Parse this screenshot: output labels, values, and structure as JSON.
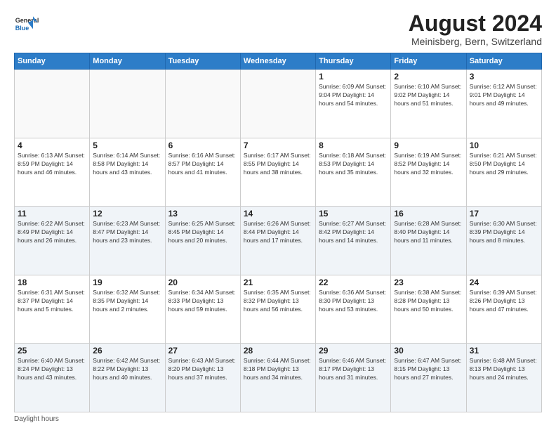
{
  "header": {
    "logo_general": "General",
    "logo_blue": "Blue",
    "month_title": "August 2024",
    "location": "Meinisberg, Bern, Switzerland"
  },
  "days_of_week": [
    "Sunday",
    "Monday",
    "Tuesday",
    "Wednesday",
    "Thursday",
    "Friday",
    "Saturday"
  ],
  "footer": {
    "label": "Daylight hours"
  },
  "weeks": [
    [
      {
        "day": "",
        "detail": ""
      },
      {
        "day": "",
        "detail": ""
      },
      {
        "day": "",
        "detail": ""
      },
      {
        "day": "",
        "detail": ""
      },
      {
        "day": "1",
        "detail": "Sunrise: 6:09 AM\nSunset: 9:04 PM\nDaylight: 14 hours\nand 54 minutes."
      },
      {
        "day": "2",
        "detail": "Sunrise: 6:10 AM\nSunset: 9:02 PM\nDaylight: 14 hours\nand 51 minutes."
      },
      {
        "day": "3",
        "detail": "Sunrise: 6:12 AM\nSunset: 9:01 PM\nDaylight: 14 hours\nand 49 minutes."
      }
    ],
    [
      {
        "day": "4",
        "detail": "Sunrise: 6:13 AM\nSunset: 8:59 PM\nDaylight: 14 hours\nand 46 minutes."
      },
      {
        "day": "5",
        "detail": "Sunrise: 6:14 AM\nSunset: 8:58 PM\nDaylight: 14 hours\nand 43 minutes."
      },
      {
        "day": "6",
        "detail": "Sunrise: 6:16 AM\nSunset: 8:57 PM\nDaylight: 14 hours\nand 41 minutes."
      },
      {
        "day": "7",
        "detail": "Sunrise: 6:17 AM\nSunset: 8:55 PM\nDaylight: 14 hours\nand 38 minutes."
      },
      {
        "day": "8",
        "detail": "Sunrise: 6:18 AM\nSunset: 8:53 PM\nDaylight: 14 hours\nand 35 minutes."
      },
      {
        "day": "9",
        "detail": "Sunrise: 6:19 AM\nSunset: 8:52 PM\nDaylight: 14 hours\nand 32 minutes."
      },
      {
        "day": "10",
        "detail": "Sunrise: 6:21 AM\nSunset: 8:50 PM\nDaylight: 14 hours\nand 29 minutes."
      }
    ],
    [
      {
        "day": "11",
        "detail": "Sunrise: 6:22 AM\nSunset: 8:49 PM\nDaylight: 14 hours\nand 26 minutes."
      },
      {
        "day": "12",
        "detail": "Sunrise: 6:23 AM\nSunset: 8:47 PM\nDaylight: 14 hours\nand 23 minutes."
      },
      {
        "day": "13",
        "detail": "Sunrise: 6:25 AM\nSunset: 8:45 PM\nDaylight: 14 hours\nand 20 minutes."
      },
      {
        "day": "14",
        "detail": "Sunrise: 6:26 AM\nSunset: 8:44 PM\nDaylight: 14 hours\nand 17 minutes."
      },
      {
        "day": "15",
        "detail": "Sunrise: 6:27 AM\nSunset: 8:42 PM\nDaylight: 14 hours\nand 14 minutes."
      },
      {
        "day": "16",
        "detail": "Sunrise: 6:28 AM\nSunset: 8:40 PM\nDaylight: 14 hours\nand 11 minutes."
      },
      {
        "day": "17",
        "detail": "Sunrise: 6:30 AM\nSunset: 8:39 PM\nDaylight: 14 hours\nand 8 minutes."
      }
    ],
    [
      {
        "day": "18",
        "detail": "Sunrise: 6:31 AM\nSunset: 8:37 PM\nDaylight: 14 hours\nand 5 minutes."
      },
      {
        "day": "19",
        "detail": "Sunrise: 6:32 AM\nSunset: 8:35 PM\nDaylight: 14 hours\nand 2 minutes."
      },
      {
        "day": "20",
        "detail": "Sunrise: 6:34 AM\nSunset: 8:33 PM\nDaylight: 13 hours\nand 59 minutes."
      },
      {
        "day": "21",
        "detail": "Sunrise: 6:35 AM\nSunset: 8:32 PM\nDaylight: 13 hours\nand 56 minutes."
      },
      {
        "day": "22",
        "detail": "Sunrise: 6:36 AM\nSunset: 8:30 PM\nDaylight: 13 hours\nand 53 minutes."
      },
      {
        "day": "23",
        "detail": "Sunrise: 6:38 AM\nSunset: 8:28 PM\nDaylight: 13 hours\nand 50 minutes."
      },
      {
        "day": "24",
        "detail": "Sunrise: 6:39 AM\nSunset: 8:26 PM\nDaylight: 13 hours\nand 47 minutes."
      }
    ],
    [
      {
        "day": "25",
        "detail": "Sunrise: 6:40 AM\nSunset: 8:24 PM\nDaylight: 13 hours\nand 43 minutes."
      },
      {
        "day": "26",
        "detail": "Sunrise: 6:42 AM\nSunset: 8:22 PM\nDaylight: 13 hours\nand 40 minutes."
      },
      {
        "day": "27",
        "detail": "Sunrise: 6:43 AM\nSunset: 8:20 PM\nDaylight: 13 hours\nand 37 minutes."
      },
      {
        "day": "28",
        "detail": "Sunrise: 6:44 AM\nSunset: 8:18 PM\nDaylight: 13 hours\nand 34 minutes."
      },
      {
        "day": "29",
        "detail": "Sunrise: 6:46 AM\nSunset: 8:17 PM\nDaylight: 13 hours\nand 31 minutes."
      },
      {
        "day": "30",
        "detail": "Sunrise: 6:47 AM\nSunset: 8:15 PM\nDaylight: 13 hours\nand 27 minutes."
      },
      {
        "day": "31",
        "detail": "Sunrise: 6:48 AM\nSunset: 8:13 PM\nDaylight: 13 hours\nand 24 minutes."
      }
    ]
  ]
}
